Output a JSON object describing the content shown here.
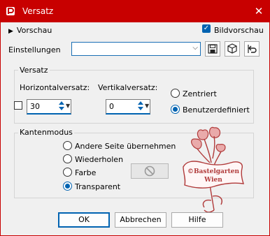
{
  "window": {
    "title": "Versatz",
    "close_glyph": "✕"
  },
  "top": {
    "preview_label": "Vorschau",
    "preview_arrow": "▶",
    "bild_label": "Bildvorschau",
    "bild_checked": true,
    "check_glyph": "✓"
  },
  "settings": {
    "label": "Einstellungen",
    "value": "",
    "dropdown_glyph": "⌵"
  },
  "versatz": {
    "title": "Versatz",
    "horizontal_label": "Horizontalversatz:",
    "horizontal_value": "30",
    "vertical_label": "Vertikalversatz:",
    "vertical_value": "0",
    "spin_dropdown_glyph": "▼",
    "options": [
      "Zentriert",
      "Benutzerdefiniert"
    ],
    "selected_option": "Benutzerdefiniert"
  },
  "kanten": {
    "title": "Kantenmodus",
    "options": [
      "Andere Seite übernehmen",
      "Wiederholen",
      "Farbe",
      "Transparent"
    ],
    "selected_option": "Transparent"
  },
  "watermark": {
    "line1": "©Bastelgarten",
    "line2": "Wien"
  },
  "buttons": {
    "ok": "OK",
    "cancel": "Abbrechen",
    "help": "Hilfe"
  },
  "colors": {
    "accent": "#0063b1",
    "titlebar": "#c80000",
    "watermark": "#b03a3a"
  }
}
